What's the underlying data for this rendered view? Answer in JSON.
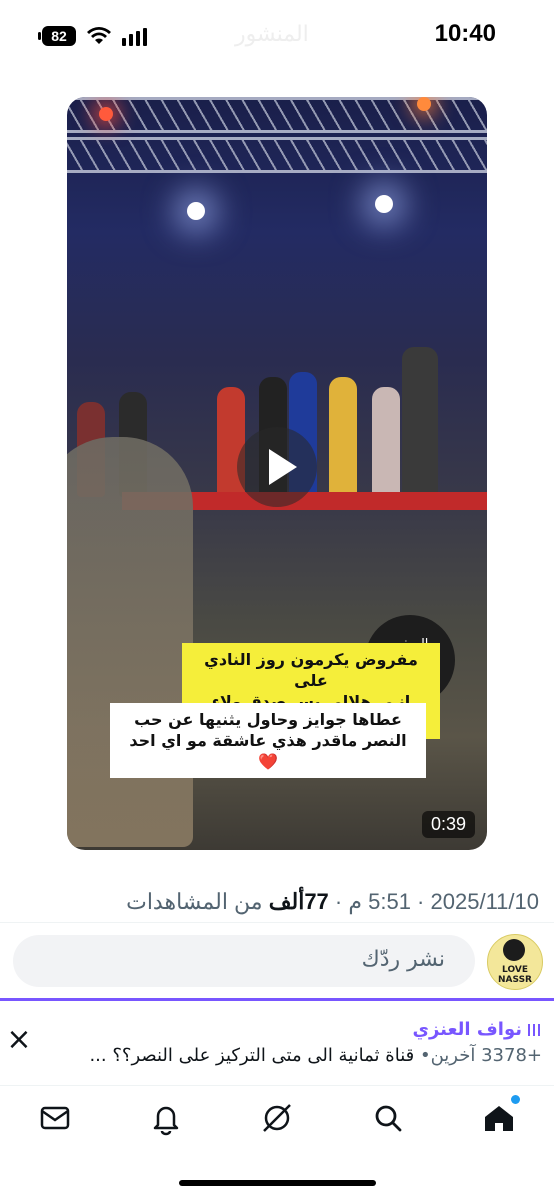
{
  "status_bar": {
    "time": "10:40",
    "battery": "82"
  },
  "video": {
    "caption_line1": "مفروض يكرمون روز النادي على",
    "caption_line2": "انـي هلالي بس صدق ولاء وعشق",
    "caption_line3": "عطاها جوايز وحاول يثنيها عن حب",
    "caption_line4": "النصر ماقدر هذي عاشقة مو اي احد ❤️",
    "badge_line1": "السفير",
    "badge_line2": "الإعلامي",
    "duration": "0:39"
  },
  "tweet_meta": {
    "date": "2025/11/10",
    "time": "5:51 م",
    "views_number": "77",
    "views_unit": "ألف",
    "views_suffix": "من المشاهدات"
  },
  "reply": {
    "placeholder": "نشر ردّك",
    "avatar_text_1": "LOVE",
    "avatar_text_2": "NASSR"
  },
  "space": {
    "host": "نواف العنزي",
    "description": "قناة ثمانية الى متى التركيز على النصر؟؟ ...",
    "listeners": "+3378 آخرين"
  },
  "tabs": [
    "home",
    "search",
    "grok",
    "notifications",
    "messages"
  ]
}
